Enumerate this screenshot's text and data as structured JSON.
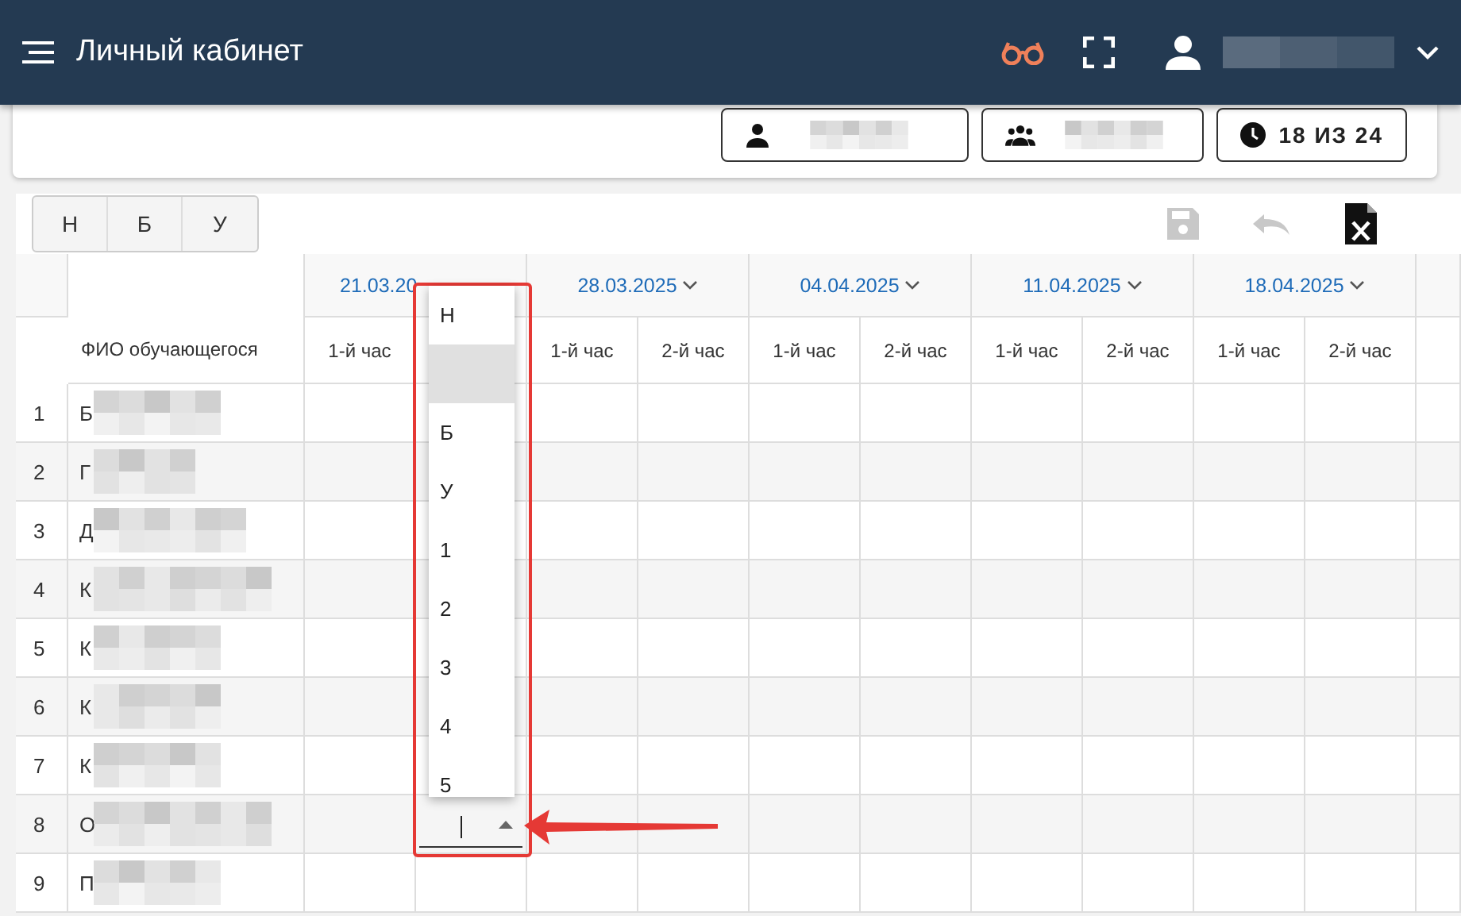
{
  "header": {
    "title": "Личный кабинет"
  },
  "info_buttons": [
    {
      "kind": "person"
    },
    {
      "kind": "group"
    },
    {
      "kind": "clock",
      "label": "18 ИЗ 24"
    }
  ],
  "mark_buttons": [
    "Н",
    "Б",
    "У"
  ],
  "toolbar": [
    {
      "kind": "save",
      "disabled": true
    },
    {
      "kind": "undo",
      "disabled": true
    },
    {
      "kind": "excel",
      "disabled": false
    }
  ],
  "table": {
    "name_header": "ФИО обучающегося",
    "dates": [
      {
        "label": "21.03.20",
        "menu": false,
        "hours": [
          "1-й час"
        ]
      },
      {
        "label": "28.03.2025",
        "menu": true,
        "hours": [
          "1-й час",
          "2-й час"
        ]
      },
      {
        "label": "04.04.2025",
        "menu": true,
        "hours": [
          "1-й час",
          "2-й час"
        ]
      },
      {
        "label": "11.04.2025",
        "menu": true,
        "hours": [
          "1-й час",
          "2-й час"
        ]
      },
      {
        "label": "18.04.2025",
        "menu": true,
        "hours": [
          "1-й час",
          "2-й час"
        ]
      }
    ],
    "rows": [
      {
        "number": "1",
        "name": "Б",
        "editing": false
      },
      {
        "number": "2",
        "name": "Г",
        "editing": false
      },
      {
        "number": "3",
        "name": "Д",
        "editing": false
      },
      {
        "number": "4",
        "name": "К",
        "editing": false
      },
      {
        "number": "5",
        "name": "К",
        "editing": false
      },
      {
        "number": "6",
        "name": "К",
        "editing": false
      },
      {
        "number": "7",
        "name": "К",
        "editing": false
      },
      {
        "number": "8",
        "name": "О",
        "editing": true
      },
      {
        "number": "9",
        "name": "П",
        "editing": false
      }
    ]
  },
  "dropdown": {
    "options": [
      {
        "label": "Н",
        "selected": false
      },
      {
        "selected": true
      },
      {
        "label": "Б",
        "selected": false
      },
      {
        "label": "У",
        "selected": false
      },
      {
        "label": "1",
        "selected": false
      },
      {
        "label": "2",
        "selected": false
      },
      {
        "label": "3",
        "selected": false
      },
      {
        "label": "4",
        "selected": false
      },
      {
        "label": "5",
        "selected": false
      }
    ]
  }
}
